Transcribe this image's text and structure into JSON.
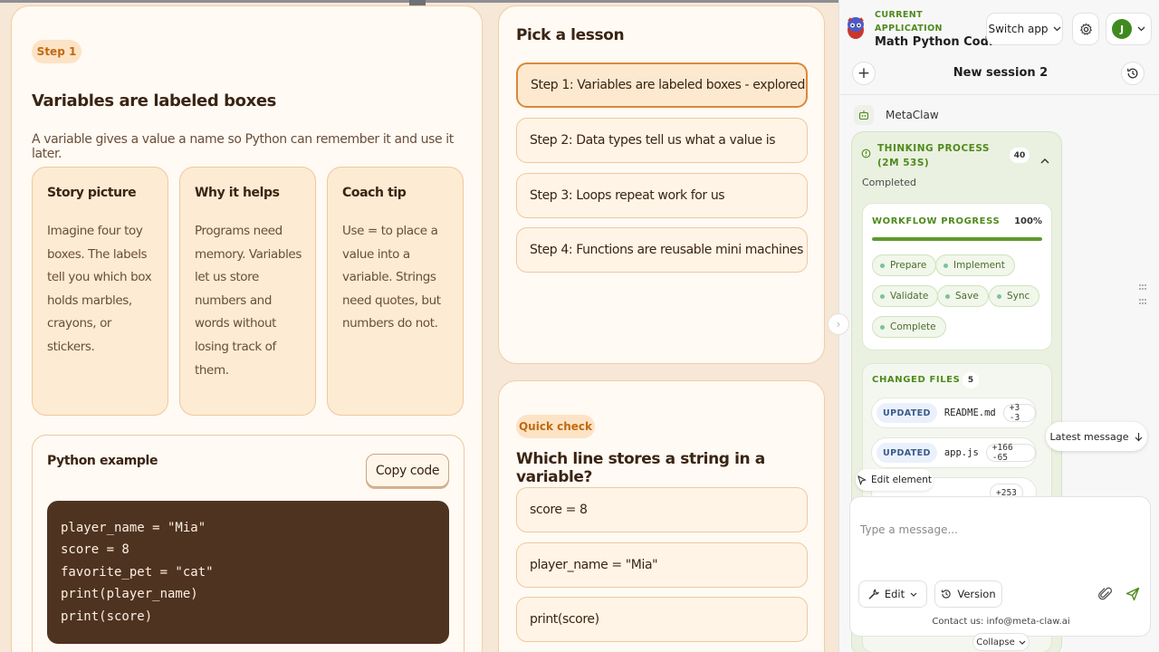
{
  "lesson": {
    "step_pill": "Step 1",
    "title": "Variables are labeled boxes",
    "subtitle": "A variable gives a value a name so Python can remember it and use it later.",
    "cards": [
      {
        "title": "Story picture",
        "body": "Imagine four toy boxes. The labels tell you which box holds marbles, crayons, or stickers."
      },
      {
        "title": "Why it helps",
        "body": "Programs need memory. Variables let us store numbers and words without losing track of them."
      },
      {
        "title": "Coach tip",
        "body": "Use = to place a value into a variable. Strings need quotes, but numbers do not."
      }
    ],
    "example": {
      "title": "Python example",
      "copy_label": "Copy code",
      "code_lines": [
        "player_name = \"Mia\"",
        "score = 8",
        "favorite_pet = \"cat\"",
        "print(player_name)",
        "print(score)"
      ]
    }
  },
  "picker": {
    "title": "Pick a lesson",
    "lessons": [
      "Step 1: Variables are labeled boxes - explored",
      "Step 2: Data types tell us what a value is",
      "Step 3: Loops repeat work for us",
      "Step 4: Functions are reusable mini machines"
    ],
    "active_index": 0
  },
  "quiz": {
    "pill": "Quick check",
    "question": "Which line stores a string in a variable?",
    "answers": [
      "score = 8",
      "player_name = \"Mia\"",
      "print(score)"
    ]
  },
  "panel": {
    "current_label": "CURRENT APPLICATION",
    "app_name": "Math Python Cod...",
    "switch_label": "Switch app",
    "user_initial": "J",
    "session_title": "New session 2",
    "bot_name": "MetaClaw",
    "thinking": {
      "title": "THINKING PROCESS (2M 53S)",
      "count": "40",
      "status": "Completed"
    },
    "workflow": {
      "label": "WORKFLOW PROGRESS",
      "percent_text": "100%",
      "progress": 1.0,
      "steps": [
        "Prepare",
        "Implement",
        "Validate",
        "Save",
        "Sync",
        "Complete"
      ]
    },
    "files": {
      "label": "CHANGED FILES",
      "count": "5",
      "items": [
        {
          "badge": "UPDATED",
          "name": "README.md",
          "diff": "+3 -3"
        },
        {
          "badge": "UPDATED",
          "name": "app.js",
          "diff": "+166 -65"
        },
        {
          "badge": "",
          "name": "",
          "diff": "+253"
        }
      ]
    },
    "latest_label": "Latest message",
    "edit_element_label": "Edit element",
    "composer": {
      "placeholder": "Type a message...",
      "edit_label": "Edit",
      "version_label": "Version",
      "contact": "Contact us: info@meta-claw.ai"
    },
    "collapse_label": "Collapse",
    "accent_color": "#4e8a1c"
  }
}
